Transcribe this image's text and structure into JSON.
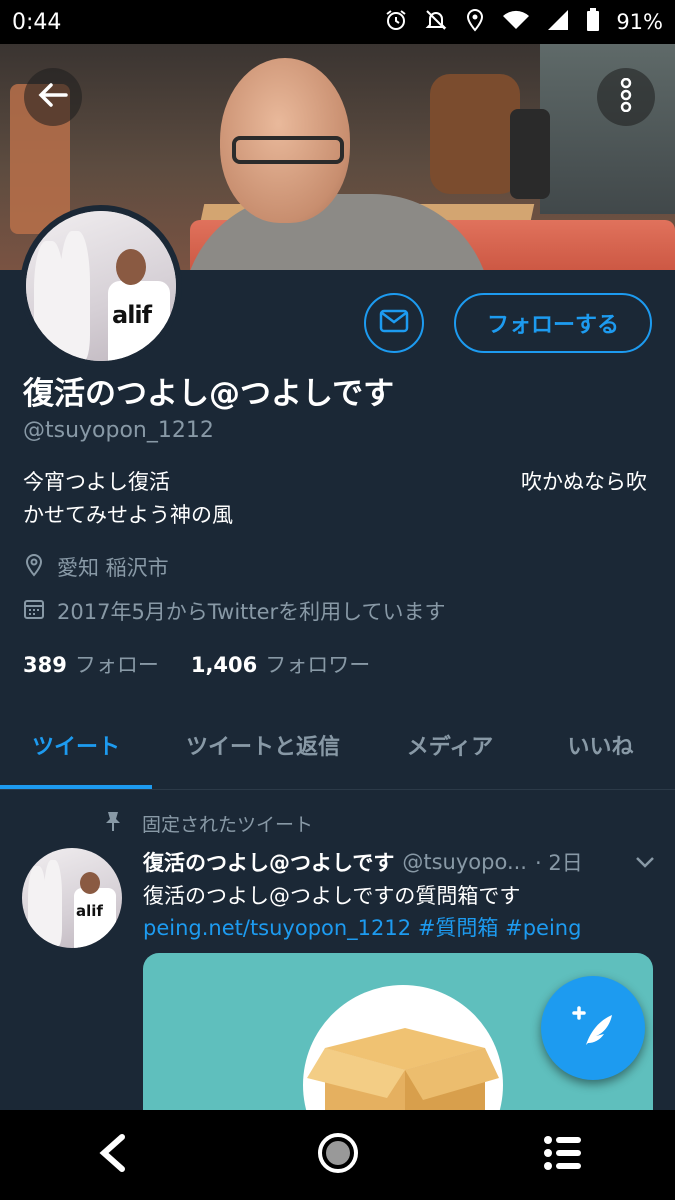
{
  "status_bar": {
    "time": "0:44",
    "battery": "91%"
  },
  "profile": {
    "display_name": "復活のつよし@つよしです",
    "handle": "@tsuyopon_1212",
    "bio_line1": "今宵つよし復活",
    "bio_line1_right": "吹かぬなら吹",
    "bio_line2": "かせてみせよう神の風",
    "location": "愛知 稲沢市",
    "joined": "2017年5月からTwitterを利用しています",
    "following_count": "389",
    "following_label": "フォロー",
    "followers_count": "1,406",
    "followers_label": "フォロワー",
    "follow_button": "フォローする",
    "avatar_shirt_text": "alif"
  },
  "tabs": [
    {
      "label": "ツイート",
      "active": true
    },
    {
      "label": "ツイートと返信",
      "active": false
    },
    {
      "label": "メディア",
      "active": false
    },
    {
      "label": "いいね",
      "active": false
    }
  ],
  "pinned_tweet": {
    "pinned_label": "固定されたツイート",
    "author_name": "復活のつよし@つよしです",
    "author_handle": "@tsuyopo...",
    "time": "· 2日",
    "text": "復活のつよし@つよしですの質問箱です",
    "link": "peing.net/tsuyopon_1212",
    "hashtag1": "#質問箱",
    "hashtag2": "#peing"
  },
  "colors": {
    "background": "#1b2836",
    "accent": "#1d9bf0",
    "secondary_text": "#8899a6"
  },
  "icons": [
    "back-arrow-icon",
    "more-vertical-icon",
    "mail-icon",
    "location-pin-icon",
    "calendar-icon",
    "pin-icon",
    "chevron-down-icon",
    "compose-tweet-icon",
    "nav-back-icon",
    "nav-home-icon",
    "nav-recents-icon",
    "alarm-icon",
    "notifications-off-icon",
    "location-icon",
    "wifi-icon",
    "signal-icon",
    "battery-icon"
  ]
}
